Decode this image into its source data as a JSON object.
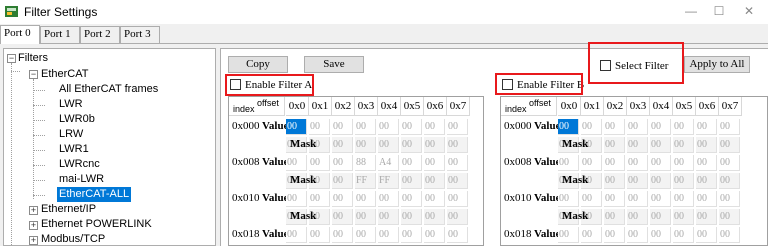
{
  "window": {
    "title": "Filter Settings",
    "minimize": "—",
    "maximize": "☐",
    "close": "✕"
  },
  "tabs": [
    "Port 0",
    "Port 1",
    "Port 2",
    "Port 3"
  ],
  "tree": {
    "root": "Filters",
    "ethercat": "EtherCAT",
    "children": [
      "All EtherCAT frames",
      "LWR",
      "LWR0b",
      "LRW",
      "LWR1",
      "LWRcnc",
      "mai-LWR",
      "EtherCAT-ALL"
    ],
    "selected": "EtherCAT-ALL",
    "siblings": [
      "Ethernet/IP",
      "Ethernet POWERLINK",
      "Modbus/TCP"
    ]
  },
  "toolbar": {
    "copy": "Copy",
    "save": "Save",
    "select_filter": "Select Filter",
    "apply_all": "Apply to All"
  },
  "filter_a": {
    "enable_label": "Enable Filter A",
    "index_label": "index",
    "offset_label": "offset",
    "columns": [
      "0x0",
      "0x1",
      "0x2",
      "0x3",
      "0x4",
      "0x5",
      "0x6",
      "0x7"
    ],
    "rows": [
      {
        "index": "0x000",
        "value": [
          "00",
          "00",
          "00",
          "00",
          "00",
          "00",
          "00",
          "00"
        ],
        "mask": [
          "00",
          "00",
          "00",
          "00",
          "00",
          "00",
          "00",
          "00"
        ]
      },
      {
        "index": "0x008",
        "value": [
          "00",
          "00",
          "00",
          "88",
          "A4",
          "00",
          "00",
          "00"
        ],
        "mask": [
          "00",
          "00",
          "00",
          "FF",
          "FF",
          "00",
          "00",
          "00"
        ]
      },
      {
        "index": "0x010",
        "value": [
          "00",
          "00",
          "00",
          "00",
          "00",
          "00",
          "00",
          "00"
        ],
        "mask": [
          "00",
          "00",
          "00",
          "00",
          "00",
          "00",
          "00",
          "00"
        ]
      },
      {
        "index": "0x018",
        "value": [
          "00",
          "00",
          "00",
          "00",
          "00",
          "00",
          "00",
          "00"
        ],
        "mask": []
      }
    ]
  },
  "filter_b": {
    "enable_label": "Enable Filter B",
    "index_label": "index",
    "offset_label": "offset",
    "columns": [
      "0x0",
      "0x1",
      "0x2",
      "0x3",
      "0x4",
      "0x5",
      "0x6",
      "0x7"
    ],
    "rows": [
      {
        "index": "0x000",
        "value": [
          "00",
          "00",
          "00",
          "00",
          "00",
          "00",
          "00",
          "00"
        ],
        "mask": [
          "00",
          "00",
          "00",
          "00",
          "00",
          "00",
          "00",
          "00"
        ]
      },
      {
        "index": "0x008",
        "value": [
          "00",
          "00",
          "00",
          "00",
          "00",
          "00",
          "00",
          "00"
        ],
        "mask": [
          "00",
          "00",
          "00",
          "00",
          "00",
          "00",
          "00",
          "00"
        ]
      },
      {
        "index": "0x010",
        "value": [
          "00",
          "00",
          "00",
          "00",
          "00",
          "00",
          "00",
          "00"
        ],
        "mask": [
          "00",
          "00",
          "00",
          "00",
          "00",
          "00",
          "00",
          "00"
        ]
      },
      {
        "index": "0x018",
        "value": [
          "00",
          "00",
          "00",
          "00",
          "00",
          "00",
          "00",
          "00"
        ],
        "mask": []
      }
    ]
  },
  "row_labels": {
    "value": "Value",
    "mask": "Mask"
  }
}
